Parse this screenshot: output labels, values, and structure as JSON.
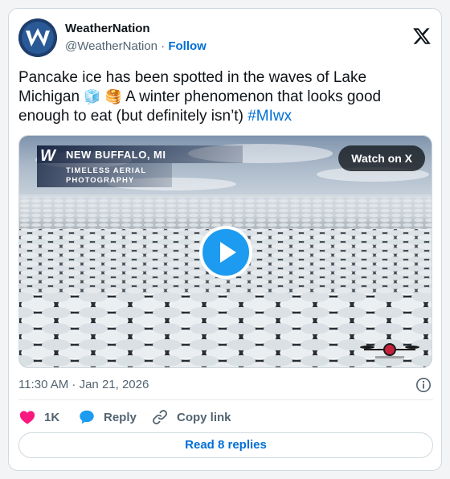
{
  "author": {
    "display_name": "WeatherNation",
    "handle": "@WeatherNation",
    "separator": " · ",
    "follow_label": "Follow",
    "avatar_icon": "weathernation-logo"
  },
  "platform_icon": "x-logo",
  "tweet": {
    "text_part1": "Pancake ice has been spotted in the waves of Lake Michigan ",
    "emoji_1": "🧊",
    "emoji_2": "🥞",
    "text_part2": " A winter phenomenon that looks good enough to eat (but definitely isn’t)  ",
    "hashtag": "#MIwx"
  },
  "media": {
    "type": "video",
    "overlay_logo": "W",
    "overlay_location": "NEW BUFFALO, MI",
    "overlay_credit": "TIMELESS AERIAL PHOTOGRAPHY",
    "watch_label": "Watch on X",
    "play_icon": "play-icon"
  },
  "timestamp": "11:30 AM · Jan 21, 2026",
  "actions": {
    "like_count": "1K",
    "reply_label": "Reply",
    "copy_label": "Copy link"
  },
  "replies_label": "Read 8 replies",
  "colors": {
    "link": "#006fd6",
    "like": "#f91880",
    "reply": "#1d9bf0",
    "play": "#1d9bf0"
  }
}
